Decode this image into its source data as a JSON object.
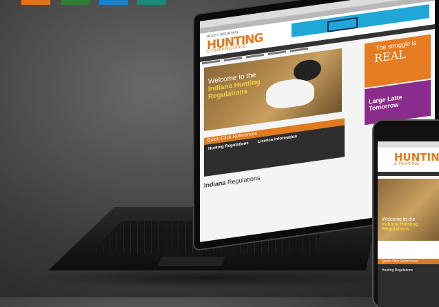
{
  "colors": {
    "orange": "#e07a1c",
    "blue": "#1fa7d8",
    "purple": "#8a2c8c",
    "dark": "#2e2e2e"
  },
  "website": {
    "logo_top": "ROCKY MOUNTAIN",
    "logo": "HUNTING",
    "logo_sub": "& TRAPPING GUIDE",
    "ad_text": "Save money today...",
    "hero_line1": "Welcome to the",
    "hero_line2": "Indiana Hunting",
    "hero_line3": "Regulations",
    "side_ad_top": "The struggle is",
    "side_ad_big": "REAL",
    "side_ad2": "Large Latte Tomorrow",
    "quick_click": "Quick-Click References",
    "col1": "Hunting Regulations",
    "col2": "Licence Information",
    "regs_bold": "Indiana",
    "regs_rest": " Regulations"
  },
  "phone": {
    "logo": "HUNTING",
    "logo_sub": "& TRAPPING",
    "hero_line1": "Welcome to the",
    "hero_line2": "Indiana Hunting",
    "hero_line3": "Regulations",
    "quick_click": "Quick-Click References",
    "col1": "Hunting Regulations"
  }
}
